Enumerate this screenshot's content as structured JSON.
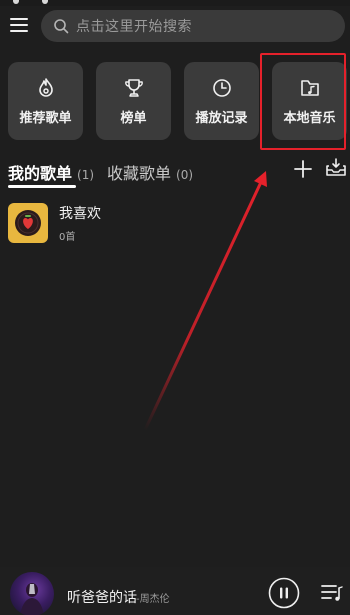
{
  "search": {
    "placeholder": "点击这里开始搜索"
  },
  "quick_actions": [
    {
      "label": "推荐歌单",
      "icon": "flame-disc-icon"
    },
    {
      "label": "榜单",
      "icon": "trophy-icon"
    },
    {
      "label": "播放记录",
      "icon": "clock-icon"
    },
    {
      "label": "本地音乐",
      "icon": "music-folder-icon"
    }
  ],
  "tabs": [
    {
      "label": "我的歌单",
      "count": "(1)",
      "active": true
    },
    {
      "label": "收藏歌单",
      "count": "(0)",
      "active": false
    }
  ],
  "playlists": [
    {
      "name": "我喜欢",
      "count": "0首"
    }
  ],
  "now_playing": {
    "title": "听爸爸的话",
    "artist": "-周杰伦",
    "state": "playing"
  },
  "colors": {
    "background": "#1e1e1e",
    "card": "#3b3b3b",
    "annotation_red": "#e5212b",
    "favorite_cover": "#e8b73f"
  }
}
